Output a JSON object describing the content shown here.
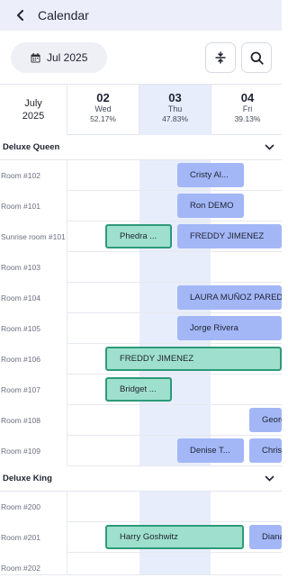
{
  "topbar": {
    "title": "Calendar",
    "back_icon": "chevron-left-icon"
  },
  "toolbar": {
    "date_label": "Jul 2025",
    "date_icon": "calendar-icon",
    "collapse_icon": "collapse-rows-icon",
    "search_icon": "search-icon"
  },
  "header": {
    "month": "July",
    "year": "2025",
    "days": [
      {
        "num": "02",
        "weekday": "Wed",
        "occupancy": "52.17%"
      },
      {
        "num": "03",
        "weekday": "Thu",
        "occupancy": "47.83%"
      },
      {
        "num": "04",
        "weekday": "Fri",
        "occupancy": "39.13%"
      }
    ]
  },
  "groups": [
    {
      "name": "Deluxe Queen"
    },
    {
      "name": "Deluxe King"
    }
  ],
  "rooms": [
    "Room #102",
    "Room #101",
    "Sunrise room #101",
    "Room #103",
    "Room #104",
    "Room #105",
    "Room #106",
    "Room #107",
    "Room #108",
    "Room #109",
    "Room #200",
    "Room #201",
    "Room #202"
  ],
  "bookings": [
    {
      "guest": "Cristy Al...",
      "style": "blue"
    },
    {
      "guest": "Ron DEMO",
      "style": "blue"
    },
    {
      "guest": "Phedra ...",
      "style": "green"
    },
    {
      "guest": "FREDDY JIMENEZ",
      "style": "blue"
    },
    {
      "guest": "LAURA MUÑOZ PAREDES",
      "style": "blue"
    },
    {
      "guest": "Jorge Rivera",
      "style": "blue"
    },
    {
      "guest": "FREDDY JIMENEZ",
      "style": "green"
    },
    {
      "guest": "Bridget ...",
      "style": "green"
    },
    {
      "guest": "Georgia",
      "style": "blue"
    },
    {
      "guest": "Denise T...",
      "style": "blue"
    },
    {
      "guest": "Chris",
      "style": "blue"
    },
    {
      "guest": "Harry Goshwitz",
      "style": "green"
    },
    {
      "guest": "Diana",
      "style": "blue"
    }
  ],
  "colors": {
    "booking_blue": "#a3b7f7",
    "booking_green": "#9ee0cd",
    "booking_green_border": "#2d9a78",
    "today_column": "#e8edfb",
    "topbar": "#eceffa"
  }
}
